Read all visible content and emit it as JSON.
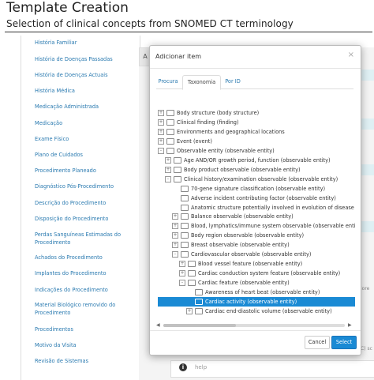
{
  "header": {
    "title": "Template Creation",
    "subtitle": "Selection of clinical concepts from SNOMED CT terminology"
  },
  "sidebar": {
    "items": [
      "História Familiar",
      "História de Doenças Passadas",
      "História de Doenças Actuais",
      "História Médica",
      "Medicação Administrada",
      "Medicação",
      "Exame Físico",
      "Plano de Cuidados",
      "Procedimento Planeado",
      "Diagnóstico Pós-Procedimento",
      "Descrição do Procedimento",
      "Disposição do Procedimento",
      "Perdas Sanguíneas Estimadas do Procedimento",
      "Achados do Procedimento",
      "Implantes do Procedimento",
      "Indicações do Procedimento",
      "Material Biológico removido do Procedimento",
      "Procedimentos",
      "Motivo da Visita",
      "Revisão de Sistemas"
    ]
  },
  "background": {
    "tab_letter": "A",
    "more_text": "iore",
    "cut_text": "C) sc",
    "help_icon": "info-icon",
    "help_placeholder": "help"
  },
  "modal": {
    "title": "Adicionar item",
    "close_glyph": "×",
    "tabs": [
      "Procura",
      "Taxonomia",
      "Por ID"
    ],
    "active_tab": "Taxonomia",
    "tree": [
      {
        "label": "Body structure (body structure)",
        "level": 0,
        "exp": "+",
        "open": false
      },
      {
        "label": "Clinical finding (finding)",
        "level": 0,
        "exp": "+",
        "open": false
      },
      {
        "label": "Environments and geographical locations",
        "level": 0,
        "exp": "+",
        "open": false
      },
      {
        "label": "Event (event)",
        "level": 0,
        "exp": "+",
        "open": false
      },
      {
        "label": "Observable entity (observable entity)",
        "level": 0,
        "exp": "-",
        "open": true
      },
      {
        "label": "Age AND/OR growth period, function (observable entity)",
        "level": 1,
        "exp": "+",
        "open": false
      },
      {
        "label": "Body product observable (observable entity)",
        "level": 1,
        "exp": "+",
        "open": false
      },
      {
        "label": "Clinical history/examination observable (observable entity)",
        "level": 1,
        "exp": "-",
        "open": true
      },
      {
        "label": "70-gene signature classification (observable entity)",
        "level": 2,
        "exp": "",
        "open": false
      },
      {
        "label": "Adverse incident contributing factor (observable entity)",
        "level": 2,
        "exp": "",
        "open": false
      },
      {
        "label": "Anatomic structure potentially involved in evolution of disease (observal",
        "level": 2,
        "exp": "",
        "open": false
      },
      {
        "label": "Balance observable (observable entity)",
        "level": 2,
        "exp": "+",
        "open": false
      },
      {
        "label": "Blood, lymphatics/immune system observable (observable entity)",
        "level": 2,
        "exp": "+",
        "open": false
      },
      {
        "label": "Body region observable (observable entity)",
        "level": 2,
        "exp": "+",
        "open": false
      },
      {
        "label": "Breast observable (observable entity)",
        "level": 2,
        "exp": "+",
        "open": false
      },
      {
        "label": "Cardiovascular observable (observable entity)",
        "level": 2,
        "exp": "-",
        "open": true
      },
      {
        "label": "Blood vessel feature (observable entity)",
        "level": 3,
        "exp": "+",
        "open": false
      },
      {
        "label": "Cardiac conduction system feature (observable entity)",
        "level": 3,
        "exp": "+",
        "open": false
      },
      {
        "label": "Cardiac feature (observable entity)",
        "level": 3,
        "exp": "-",
        "open": true
      },
      {
        "label": "Awareness of heart beat (observable entity)",
        "level": 4,
        "exp": "",
        "open": false
      },
      {
        "label": "Cardiac activity (observable entity)",
        "level": 4,
        "exp": "",
        "open": false,
        "selected": true
      },
      {
        "label": "Cardiac end-diastolic volume (observable entity)",
        "level": 4,
        "exp": "+",
        "open": false
      }
    ],
    "scroll_left": "◀",
    "scroll_right": "▶",
    "cancel_label": "Cancel",
    "select_label": "Select"
  }
}
